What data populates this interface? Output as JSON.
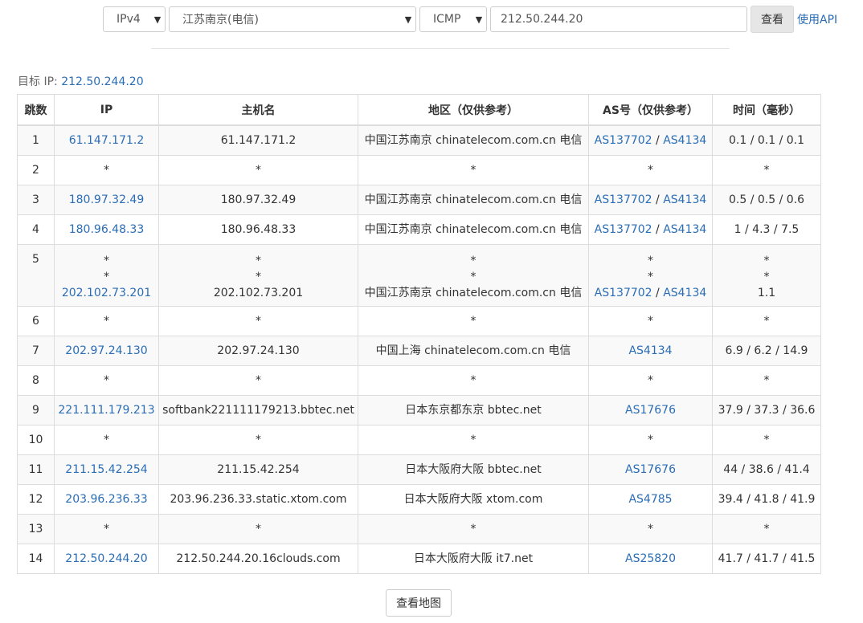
{
  "toolbar": {
    "protocol_version": "IPv4",
    "node": "江苏南京(电信)",
    "method": "ICMP",
    "target_value": "212.50.244.20",
    "query_label": "查看",
    "api_label": "使用API"
  },
  "target": {
    "label": "目标 IP:",
    "ip": "212.50.244.20"
  },
  "table": {
    "headers": [
      "跳数",
      "IP",
      "主机名",
      "地区（仅供参考）",
      "AS号（仅供参考）",
      "时间（毫秒）"
    ],
    "rows": [
      {
        "hop": "1",
        "ip": "61.147.171.2",
        "host": "61.147.171.2",
        "region": "中国江苏南京 chinatelecom.com.cn 电信",
        "as1": "AS137702",
        "as2": "AS4134",
        "time": "0.1 / 0.1 / 0.1"
      },
      {
        "hop": "2",
        "ip": "*",
        "host": "*",
        "region": "*",
        "as1": "*",
        "as2": "",
        "time": "*"
      },
      {
        "hop": "3",
        "ip": "180.97.32.49",
        "host": "180.97.32.49",
        "region": "中国江苏南京 chinatelecom.com.cn 电信",
        "as1": "AS137702",
        "as2": "AS4134",
        "time": "0.5 / 0.5 / 0.6"
      },
      {
        "hop": "4",
        "ip": "180.96.48.33",
        "host": "180.96.48.33",
        "region": "中国江苏南京 chinatelecom.com.cn 电信",
        "as1": "AS137702",
        "as2": "AS4134",
        "time": "1 / 4.3 / 7.5"
      },
      {
        "hop": "5",
        "ip": "202.102.73.201",
        "host": "202.102.73.201",
        "region": "中国江苏南京 chinatelecom.com.cn 电信",
        "as1": "AS137702",
        "as2": "AS4134",
        "time": "1.1",
        "star": "*"
      },
      {
        "hop": "6",
        "ip": "*",
        "host": "*",
        "region": "*",
        "as1": "*",
        "as2": "",
        "time": "*"
      },
      {
        "hop": "7",
        "ip": "202.97.24.130",
        "host": "202.97.24.130",
        "region": "中国上海 chinatelecom.com.cn 电信",
        "as1": "AS4134",
        "as2": "",
        "time": "6.9 / 6.2 / 14.9"
      },
      {
        "hop": "8",
        "ip": "*",
        "host": "*",
        "region": "*",
        "as1": "*",
        "as2": "",
        "time": "*"
      },
      {
        "hop": "9",
        "ip": "221.111.179.213",
        "host": "softbank221111179213.bbtec.net",
        "region": "日本东京都东京 bbtec.net",
        "as1": "AS17676",
        "as2": "",
        "time": "37.9 / 37.3 / 36.6"
      },
      {
        "hop": "10",
        "ip": "*",
        "host": "*",
        "region": "*",
        "as1": "*",
        "as2": "",
        "time": "*"
      },
      {
        "hop": "11",
        "ip": "211.15.42.254",
        "host": "211.15.42.254",
        "region": "日本大阪府大阪 bbtec.net",
        "as1": "AS17676",
        "as2": "",
        "time": "44 / 38.6 / 41.4"
      },
      {
        "hop": "12",
        "ip": "203.96.236.33",
        "host": "203.96.236.33.static.xtom.com",
        "region": "日本大阪府大阪 xtom.com",
        "as1": "AS4785",
        "as2": "",
        "time": "39.4 / 41.8 / 41.9"
      },
      {
        "hop": "13",
        "ip": "*",
        "host": "*",
        "region": "*",
        "as1": "*",
        "as2": "",
        "time": "*"
      },
      {
        "hop": "14",
        "ip": "212.50.244.20",
        "host": "212.50.244.20.16clouds.com",
        "region": "日本大阪府大阪 it7.net",
        "as1": "AS25820",
        "as2": "",
        "time": "41.7 / 41.7 / 41.5"
      }
    ]
  },
  "map_button_label": "查看地图",
  "colors": {
    "link": "#2a6db5",
    "stripe": "#f9f9f9",
    "border": "#dddddd",
    "button_gray": "#e6e6e6"
  }
}
